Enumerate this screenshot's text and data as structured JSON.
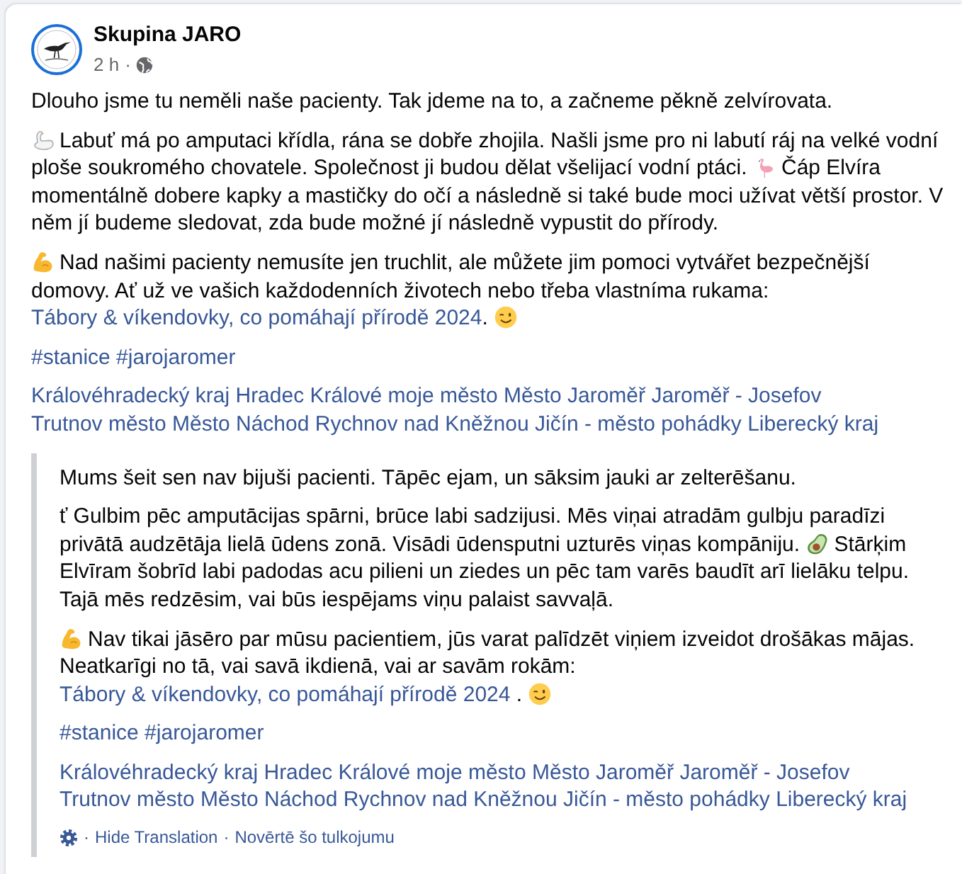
{
  "post": {
    "author": "Skupina JARO",
    "time": "2 h",
    "separator": "·",
    "paragraphs": [
      [
        {
          "kind": "text",
          "text": "Dlouho jsme tu neměli naše pacienty. Tak jdeme na to, a začneme pěkně zelvírovata."
        }
      ],
      [
        {
          "kind": "emoji"
        },
        {
          "kind": "text",
          "text": "Labuť má po amputaci křídla, rána se dobře zhojila. Našli jsme pro ni labutí ráj na velké vodní ploše soukromého chovatele. Společnost ji budou dělat všelijací vodní ptáci. "
        },
        {
          "kind": "emoji"
        },
        {
          "kind": "text",
          "text": "Čáp Elvíra momentálně dobere kapky a mastičky do očí a následně si také bude moci užívat větší prostor. V něm jí budeme sledovat, zda bude možné jí následně vypustit do přírody."
        }
      ],
      [
        {
          "kind": "emoji"
        },
        {
          "kind": "text",
          "text": "Nad našimi pacienty nemusíte jen truchlit, ale můžete jim pomoci vytvářet bezpečnější domovy. Ať už ve vašich každodenních životech nebo třeba vlastníma rukama: "
        },
        {
          "kind": "link",
          "text": "Tábory & víkendovky, co pomáhají přírodě 2024"
        },
        {
          "kind": "text",
          "text": ". "
        },
        {
          "kind": "emoji"
        }
      ]
    ],
    "hashtags": [
      "#stanice",
      "#jarojaromer"
    ],
    "place_tags": [
      "Královéhradecký kraj",
      "Hradec Králové moje město",
      "Město Jaroměř",
      "Jaroměř - Josefov",
      "Trutnov město",
      "Město Náchod",
      "Rychnov nad Kněžnou",
      "Jičín - město pohádky",
      "Liberecký kraj"
    ]
  },
  "translation": {
    "paragraphs": [
      [
        {
          "kind": "text",
          "text": "Mums šeit sen nav bijuši pacienti. Tāpēc ejam, un sāksim jauki ar zelterēšanu."
        }
      ],
      [
        {
          "kind": "text",
          "text": "ť Gulbim pēc amputācijas spārni, brūce labi sadzijusi. Mēs viņai atradām gulbju paradīzi privātā audzētāja lielā ūdens zonā. Visādi ūdensputni uzturēs viņas kompāniju. "
        },
        {
          "kind": "emoji"
        },
        {
          "kind": "text",
          "text": "Stārķim Elvīram šobrīd labi padodas acu pilieni un ziedes un pēc tam varēs baudīt arī lielāku telpu. Tajā mēs redzēsim, vai būs iespējams viņu palaist savvaļā."
        }
      ],
      [
        {
          "kind": "emoji"
        },
        {
          "kind": "text",
          "text": "Nav tikai jāsēro par mūsu pacientiem, jūs varat palīdzēt viņiem izveidot drošākas mājas. Neatkarīgi no tā, vai savā ikdienā, vai ar savām rokām: "
        },
        {
          "kind": "link",
          "text": "Tábory & víkendovky, co pomáhají přírodě 2024"
        },
        {
          "kind": "text",
          "text": " . "
        },
        {
          "kind": "emoji"
        }
      ]
    ],
    "hashtags": [
      "#stanice",
      "#jarojaromer"
    ],
    "place_tags": [
      "Královéhradecký kraj",
      "Hradec Králové moje město",
      "Město Jaroměř",
      "Jaroměř - Josefov",
      "Trutnov město",
      "Město Náchod",
      "Rychnov nad Kněžnou",
      "Jičín - město pohádky",
      "Liberecký kraj"
    ],
    "footer": [
      {
        "kind": "settings"
      },
      {
        "kind": "separator",
        "text": "·"
      },
      {
        "kind": "link",
        "text": "Hide Translation"
      },
      {
        "kind": "separator",
        "text": "·"
      },
      {
        "kind": "link",
        "text": "Novērtē šo tulkojumu"
      }
    ]
  }
}
